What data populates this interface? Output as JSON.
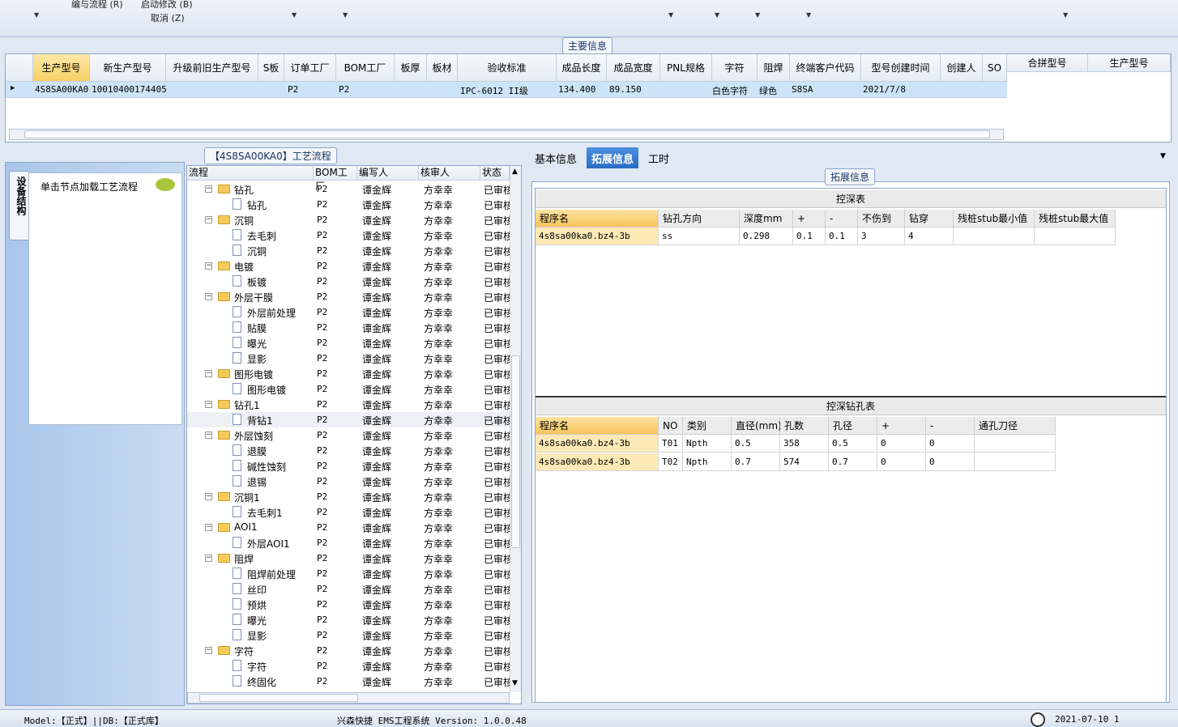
{
  "menu": {
    "edit_flow": "编与流程 (R)",
    "start_modify": "启动修改 (B)",
    "cancel": "取消 (Z)"
  },
  "main_info": {
    "section_title": "主要信息",
    "columns": [
      "生产型号",
      "新生产型号",
      "升级前旧生产型号",
      "S板",
      "订单工厂",
      "BOM工厂",
      "板厚",
      "板材",
      "验收标准",
      "成品长度",
      "成品宽度",
      "PNL规格",
      "字符",
      "阻焊",
      "终端客户代码",
      "型号创建时间",
      "创建人",
      "SO"
    ],
    "row": {
      "model": "4S8SA00KA0",
      "new_model": "10010400174405",
      "order_factory": "P2",
      "bom_factory": "P2",
      "standard": "IPC-6012 II级",
      "length": "134.400",
      "width": "89.150",
      "char": "白色字符",
      "solder": "绿色",
      "customer": "S8SA",
      "created": "2021/7/8"
    },
    "side_columns": [
      "合拼型号",
      "生产型号"
    ]
  },
  "left_panel": {
    "vertical_tab": "设备结构",
    "hint": "单击节点加载工艺流程"
  },
  "flow": {
    "title": "【4S8SA00KA0】工艺流程",
    "columns": [
      "流程",
      "BOM工厂",
      "编写人",
      "核审人",
      "状态"
    ],
    "rows": [
      {
        "name": "钻孔",
        "type": "folder",
        "factory": "P2",
        "writer": "谭金辉",
        "reviewer": "方幸幸",
        "status": "已审核"
      },
      {
        "name": "钻孔",
        "type": "doc",
        "factory": "P2",
        "writer": "谭金辉",
        "reviewer": "方幸幸",
        "status": "已审核"
      },
      {
        "name": "沉铜",
        "type": "folder",
        "factory": "P2",
        "writer": "谭金辉",
        "reviewer": "方幸幸",
        "status": "已审核"
      },
      {
        "name": "去毛刺",
        "type": "doc",
        "factory": "P2",
        "writer": "谭金辉",
        "reviewer": "方幸幸",
        "status": "已审核"
      },
      {
        "name": "沉铜",
        "type": "doc",
        "factory": "P2",
        "writer": "谭金辉",
        "reviewer": "方幸幸",
        "status": "已审核"
      },
      {
        "name": "电镀",
        "type": "folder",
        "factory": "P2",
        "writer": "谭金辉",
        "reviewer": "方幸幸",
        "status": "已审核"
      },
      {
        "name": "板镀",
        "type": "doc",
        "factory": "P2",
        "writer": "谭金辉",
        "reviewer": "方幸幸",
        "status": "已审核"
      },
      {
        "name": "外层干膜",
        "type": "folder",
        "factory": "P2",
        "writer": "谭金辉",
        "reviewer": "方幸幸",
        "status": "已审核"
      },
      {
        "name": "外层前处理",
        "type": "doc",
        "factory": "P2",
        "writer": "谭金辉",
        "reviewer": "方幸幸",
        "status": "已审核"
      },
      {
        "name": "贴膜",
        "type": "doc",
        "factory": "P2",
        "writer": "谭金辉",
        "reviewer": "方幸幸",
        "status": "已审核"
      },
      {
        "name": "曝光",
        "type": "doc",
        "factory": "P2",
        "writer": "谭金辉",
        "reviewer": "方幸幸",
        "status": "已审核"
      },
      {
        "name": "显影",
        "type": "doc",
        "factory": "P2",
        "writer": "谭金辉",
        "reviewer": "方幸幸",
        "status": "已审核"
      },
      {
        "name": "图形电镀",
        "type": "folder",
        "factory": "P2",
        "writer": "谭金辉",
        "reviewer": "方幸幸",
        "status": "已审核"
      },
      {
        "name": "图形电镀",
        "type": "doc",
        "factory": "P2",
        "writer": "谭金辉",
        "reviewer": "方幸幸",
        "status": "已审核"
      },
      {
        "name": "钻孔1",
        "type": "folder",
        "factory": "P2",
        "writer": "谭金辉",
        "reviewer": "方幸幸",
        "status": "已审核"
      },
      {
        "name": "背钻1",
        "type": "doc",
        "factory": "P2",
        "writer": "谭金辉",
        "reviewer": "方幸幸",
        "status": "已审核",
        "highlight": true
      },
      {
        "name": "外层蚀刻",
        "type": "folder",
        "factory": "P2",
        "writer": "谭金辉",
        "reviewer": "方幸幸",
        "status": "已审核"
      },
      {
        "name": "退膜",
        "type": "doc",
        "factory": "P2",
        "writer": "谭金辉",
        "reviewer": "方幸幸",
        "status": "已审核"
      },
      {
        "name": "碱性蚀刻",
        "type": "doc",
        "factory": "P2",
        "writer": "谭金辉",
        "reviewer": "方幸幸",
        "status": "已审核"
      },
      {
        "name": "退锡",
        "type": "doc",
        "factory": "P2",
        "writer": "谭金辉",
        "reviewer": "方幸幸",
        "status": "已审核"
      },
      {
        "name": "沉铜1",
        "type": "folder",
        "factory": "P2",
        "writer": "谭金辉",
        "reviewer": "方幸幸",
        "status": "已审核"
      },
      {
        "name": "去毛刺1",
        "type": "doc",
        "factory": "P2",
        "writer": "谭金辉",
        "reviewer": "方幸幸",
        "status": "已审核"
      },
      {
        "name": "AOI1",
        "type": "folder",
        "factory": "P2",
        "writer": "谭金辉",
        "reviewer": "方幸幸",
        "status": "已审核"
      },
      {
        "name": "外层AOI1",
        "type": "doc",
        "factory": "P2",
        "writer": "谭金辉",
        "reviewer": "方幸幸",
        "status": "已审核"
      },
      {
        "name": "阻焊",
        "type": "folder",
        "factory": "P2",
        "writer": "谭金辉",
        "reviewer": "方幸幸",
        "status": "已审核"
      },
      {
        "name": "阻焊前处理",
        "type": "doc",
        "factory": "P2",
        "writer": "谭金辉",
        "reviewer": "方幸幸",
        "status": "已审核"
      },
      {
        "name": "丝印",
        "type": "doc",
        "factory": "P2",
        "writer": "谭金辉",
        "reviewer": "方幸幸",
        "status": "已审核"
      },
      {
        "name": "预烘",
        "type": "doc",
        "factory": "P2",
        "writer": "谭金辉",
        "reviewer": "方幸幸",
        "status": "已审核"
      },
      {
        "name": "曝光",
        "type": "doc",
        "factory": "P2",
        "writer": "谭金辉",
        "reviewer": "方幸幸",
        "status": "已审核"
      },
      {
        "name": "显影",
        "type": "doc",
        "factory": "P2",
        "writer": "谭金辉",
        "reviewer": "方幸幸",
        "status": "已审核"
      },
      {
        "name": "字符",
        "type": "folder",
        "factory": "P2",
        "writer": "谭金辉",
        "reviewer": "方幸幸",
        "status": "已审核"
      },
      {
        "name": "字符",
        "type": "doc",
        "factory": "P2",
        "writer": "谭金辉",
        "reviewer": "方幸幸",
        "status": "已审核"
      },
      {
        "name": "终固化",
        "type": "doc",
        "factory": "P2",
        "writer": "谭金辉",
        "reviewer": "方幸幸",
        "status": "已审核"
      }
    ]
  },
  "tabs": [
    "基本信息",
    "拓展信息",
    "工时"
  ],
  "active_tab": "拓展信息",
  "ext_info": {
    "section_title": "拓展信息",
    "depth_table": {
      "title": "控深表",
      "columns": [
        "程序名",
        "钻孔方向",
        "深度mm",
        "+",
        "-",
        "不伤到",
        "钻穿",
        "残桩stub最小值",
        "残桩stub最大值"
      ],
      "rows": [
        [
          "4s8sa00ka0.bz4-3b",
          "ss",
          "0.298",
          "0.1",
          "0.1",
          "3",
          "4",
          "",
          ""
        ]
      ]
    },
    "hole_table": {
      "title": "控深钻孔表",
      "columns": [
        "程序名",
        "NO",
        "类别",
        "直径(mm)",
        "孔数",
        "孔径",
        "+",
        "-",
        "通孔刀径"
      ],
      "rows": [
        [
          "4s8sa00ka0.bz4-3b",
          "T01",
          "Npth",
          "0.5",
          "358",
          "0.5",
          "0",
          "0",
          ""
        ],
        [
          "4s8sa00ka0.bz4-3b",
          "T02",
          "Npth",
          "0.7",
          "574",
          "0.7",
          "0",
          "0",
          ""
        ]
      ]
    }
  },
  "status": {
    "model": "Model:【正式】||DB:【正式库】",
    "app": "兴森快捷 EMS工程系统 Version: 1.0.0.48",
    "datetime": "2021-07-10 1"
  }
}
